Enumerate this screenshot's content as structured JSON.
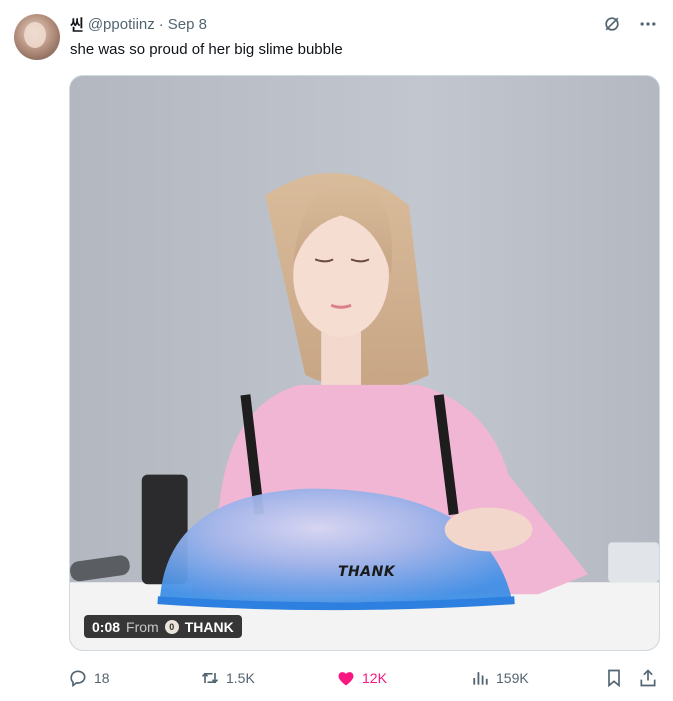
{
  "tweet": {
    "author_name": "씬",
    "handle": "@ppotiinz",
    "separator": "·",
    "date": "Sep 8",
    "text": "she was so proud of her big slime bubble"
  },
  "media": {
    "duration": "0:08",
    "from_label": "From",
    "source_logo_char": "0",
    "source_name": "THANK",
    "watermark": "THANK"
  },
  "actions": {
    "replies": "18",
    "reposts": "1.5K",
    "likes": "12K",
    "views": "159K",
    "like_color": "#f91880"
  },
  "icons": {
    "header": [
      "grok-icon",
      "more-icon"
    ],
    "actions": [
      "reply-icon",
      "repost-icon",
      "heart-icon",
      "views-icon",
      "bookmark-icon",
      "share-icon"
    ]
  }
}
